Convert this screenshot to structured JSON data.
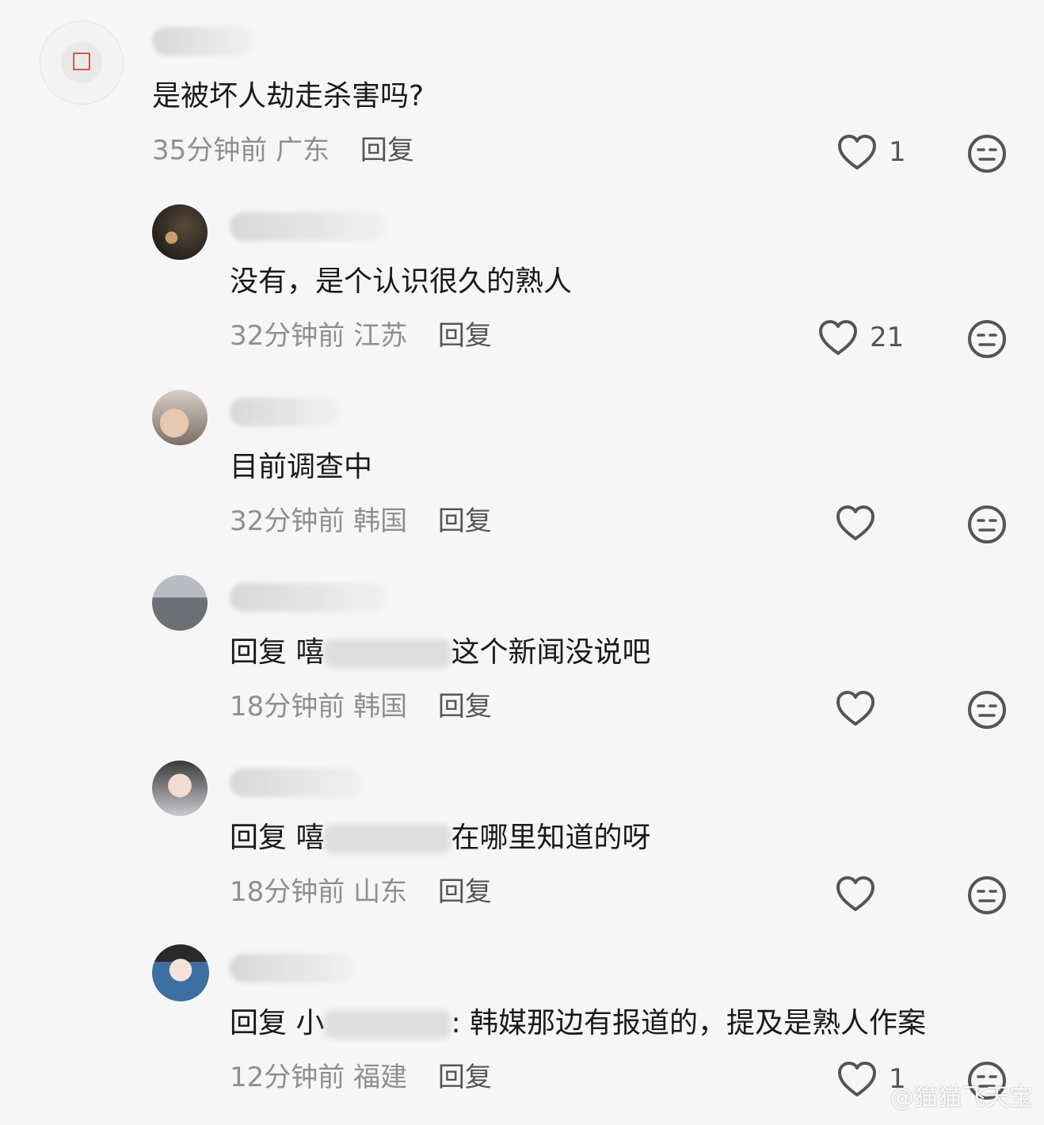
{
  "comments": [
    {
      "text_before": "是被坏人劫走杀害吗?",
      "text_after": "",
      "time": "35分钟前",
      "location": "广东",
      "reply_label": "回复",
      "likes": "1"
    },
    {
      "text_before": "没有，是个认识很久的熟人",
      "text_after": "",
      "time": "32分钟前",
      "location": "江苏",
      "reply_label": "回复",
      "likes": "21"
    },
    {
      "text_before": "目前调查中",
      "text_after": "",
      "time": "32分钟前",
      "location": "韩国",
      "reply_label": "回复",
      "likes": ""
    },
    {
      "text_before": "回复 嘻",
      "text_after": "这个新闻没说吧",
      "time": "18分钟前",
      "location": "韩国",
      "reply_label": "回复",
      "likes": ""
    },
    {
      "text_before": "回复 嘻",
      "text_after": "在哪里知道的呀",
      "time": "18分钟前",
      "location": "山东",
      "reply_label": "回复",
      "likes": ""
    },
    {
      "text_before": "回复 小",
      "text_after": ": 韩媒那边有报道的，提及是熟人作案",
      "time": "12分钟前",
      "location": "福建",
      "reply_label": "回复",
      "likes": "1"
    }
  ],
  "watermark": "@猫猫飞天宝",
  "icons": {
    "like": "heart-outline-icon",
    "dislike": "neutral-face-icon"
  },
  "colors": {
    "background": "#f6f6f6",
    "text": "#1a1a1a",
    "meta": "#8f8f8f",
    "icon": "#555555"
  }
}
